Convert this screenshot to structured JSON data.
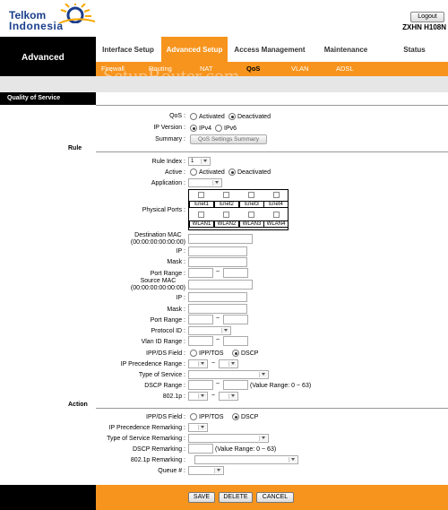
{
  "brand": {
    "line1": "Telkom",
    "line2": "Indonesia"
  },
  "header": {
    "logout": "Logout",
    "model": "ZXHN H108N"
  },
  "sidebar": {
    "title": "Advanced",
    "section": "Quality of Service"
  },
  "tabs": [
    {
      "label": "Interface Setup",
      "active": false
    },
    {
      "label": "Advanced Setup",
      "active": true
    },
    {
      "label": "Access Management",
      "active": false
    },
    {
      "label": "Maintenance",
      "active": false
    },
    {
      "label": "Status",
      "active": false
    }
  ],
  "subtabs": [
    "Firewall",
    "Routing",
    "NAT",
    "QoS",
    "VLAN",
    "ADSL"
  ],
  "watermark": "SetupRouter.com",
  "qos": {
    "label": "QoS :",
    "activated": "Activated",
    "deactivated": "Deactivated",
    "ipversion": "IP Version :",
    "ipv4": "IPv4",
    "ipv6": "IPv6",
    "summary": "Summary :",
    "summary_btn": "QoS Settings Summary"
  },
  "rule": {
    "title": "Rule",
    "rule_index": "Rule Index :",
    "rule_index_val": "1",
    "active": "Active :",
    "activated": "Activated",
    "deactivated": "Deactivated",
    "application": "Application :",
    "physical_ports": "Physical Ports :",
    "enet": [
      "Enet1",
      "Enet2",
      "Enet3",
      "Enet4"
    ],
    "wlan": [
      "WLAN1",
      "WLAN2",
      "WLAN3",
      "WLAN4"
    ],
    "dest_mac": "Destination MAC",
    "mac_hint": "(00:00:00:00:00:00)",
    "ip": "IP :",
    "mask": "Mask :",
    "port_range": "Port Range :",
    "src_mac": "Source MAC",
    "protocol_id": "Protocol ID :",
    "vlan_range": "Vlan ID Range :",
    "ippds": "IPP/DS Field :",
    "ipptos": "IPP/TOS",
    "dscp": "DSCP",
    "ipp_range": "IP Precedence Range :",
    "tos": "Type of Service :",
    "dscp_range": "DSCP Range :",
    "dscp_hint": "(Value Range: 0 ~ 63)",
    "dot1p": "802.1p :",
    "tilde": "~"
  },
  "action": {
    "title": "Action",
    "ippds": "IPP/DS Field :",
    "ipptos": "IPP/TOS",
    "dscp": "DSCP",
    "ipp_remark": "IP Precedence Remarking :",
    "tos_remark": "Type of Service Remarking :",
    "dscp_remark": "DSCP Remarking :",
    "dscp_hint": "(Value Range: 0 ~ 63)",
    "dot1p_remark": "802.1p Remarking :",
    "queue": "Queue # :"
  },
  "footer": {
    "save": "SAVE",
    "delete": "DELETE",
    "cancel": "CANCEL"
  },
  "colors": {
    "accent": "#f7941d",
    "brand": "#1a3e8c"
  }
}
